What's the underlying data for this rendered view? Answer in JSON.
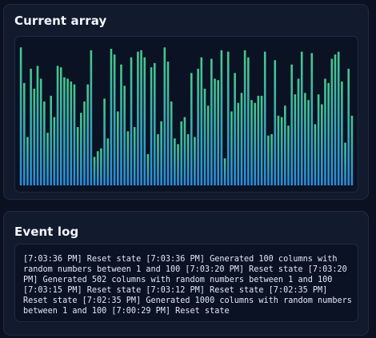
{
  "current_array": {
    "title": "Current array",
    "column_count": 100,
    "min_value": 1,
    "max_value": 100,
    "values": [
      97,
      72,
      34,
      82,
      68,
      84,
      75,
      59,
      37,
      63,
      48,
      84,
      83,
      76,
      75,
      73,
      71,
      41,
      51,
      59,
      71,
      95,
      20,
      24,
      26,
      61,
      33,
      96,
      92,
      52,
      85,
      70,
      38,
      90,
      41,
      94,
      95,
      90,
      22,
      83,
      86,
      36,
      45,
      97,
      87,
      59,
      33,
      29,
      45,
      48,
      36,
      79,
      34,
      82,
      90,
      68,
      56,
      89,
      75,
      74,
      95,
      19,
      94,
      52,
      79,
      58,
      65,
      95,
      90,
      60,
      58,
      63,
      63,
      94,
      35,
      36,
      88,
      49,
      48,
      56,
      42,
      85,
      64,
      75,
      94,
      65,
      60,
      93,
      43,
      64,
      57,
      75,
      72,
      89,
      92,
      94,
      73,
      30,
      82,
      49
    ],
    "bar_gradient": {
      "top": "#46c98c",
      "bottom": "#2a8ad8"
    }
  },
  "event_log": {
    "title": "Event log",
    "text": "[7:03:36 PM] Reset state [7:03:36 PM] Generated 100 columns with random numbers between 1 and 100 [7:03:20 PM] Reset state [7:03:20 PM] Generated 502 columns with random numbers between 1 and 100 [7:03:15 PM] Reset state [7:03:12 PM] Reset state [7:02:35 PM] Reset state [7:02:35 PM] Generated 1000 columns with random numbers between 1 and 100 [7:00:29 PM] Reset state"
  }
}
